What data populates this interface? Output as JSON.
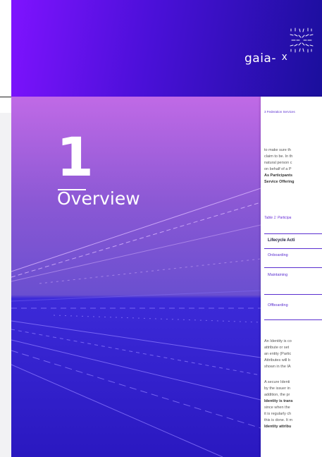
{
  "brand": {
    "logo_text": "gaia-",
    "logo_x": "x"
  },
  "cover": {
    "chapter_number": "1",
    "chapter_title": "Overview"
  },
  "page": {
    "running_head": "3  Federation Services",
    "para1": [
      "to make sure th",
      "claim to be. In th",
      "natural person c",
      "on behalf of a P",
      "As Participants",
      "Service Offering"
    ],
    "table_caption": "Table 1: Participa",
    "table_header": "Lifecycle Acti",
    "table_rows": [
      "Onboarding",
      "Maintaining",
      "Offboarding"
    ],
    "para2": [
      "An Identity is co",
      "attribute or set",
      "an entity (Partic",
      "Attributes will b",
      "shown in the IA"
    ],
    "para3": [
      "A secure Identi",
      "by the issuer in",
      "addition, the pr",
      "Identity is trans",
      "since when the",
      "it is regularly ch",
      "this is done. It m",
      "Identity attribu"
    ]
  }
}
